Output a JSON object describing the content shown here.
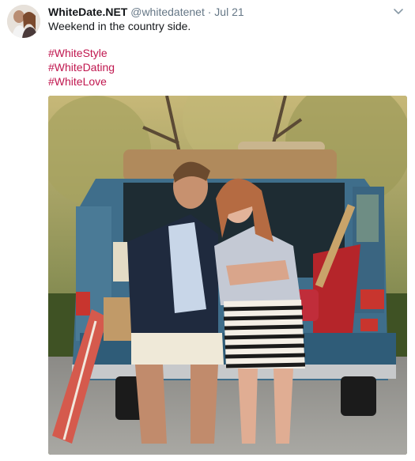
{
  "tweet": {
    "display_name": "WhiteDate.NET",
    "handle": "@whitedatenet",
    "separator": "·",
    "date": "Jul 21",
    "text": "Weekend in the country side.",
    "hashtags": [
      "#WhiteStyle",
      "#WhiteDating",
      "#WhiteLove"
    ]
  },
  "icons": {
    "menu": "chevron-down-icon"
  },
  "colors": {
    "hashtag": "#c0174f",
    "muted": "#657786",
    "truck": "#3f6e8b"
  }
}
